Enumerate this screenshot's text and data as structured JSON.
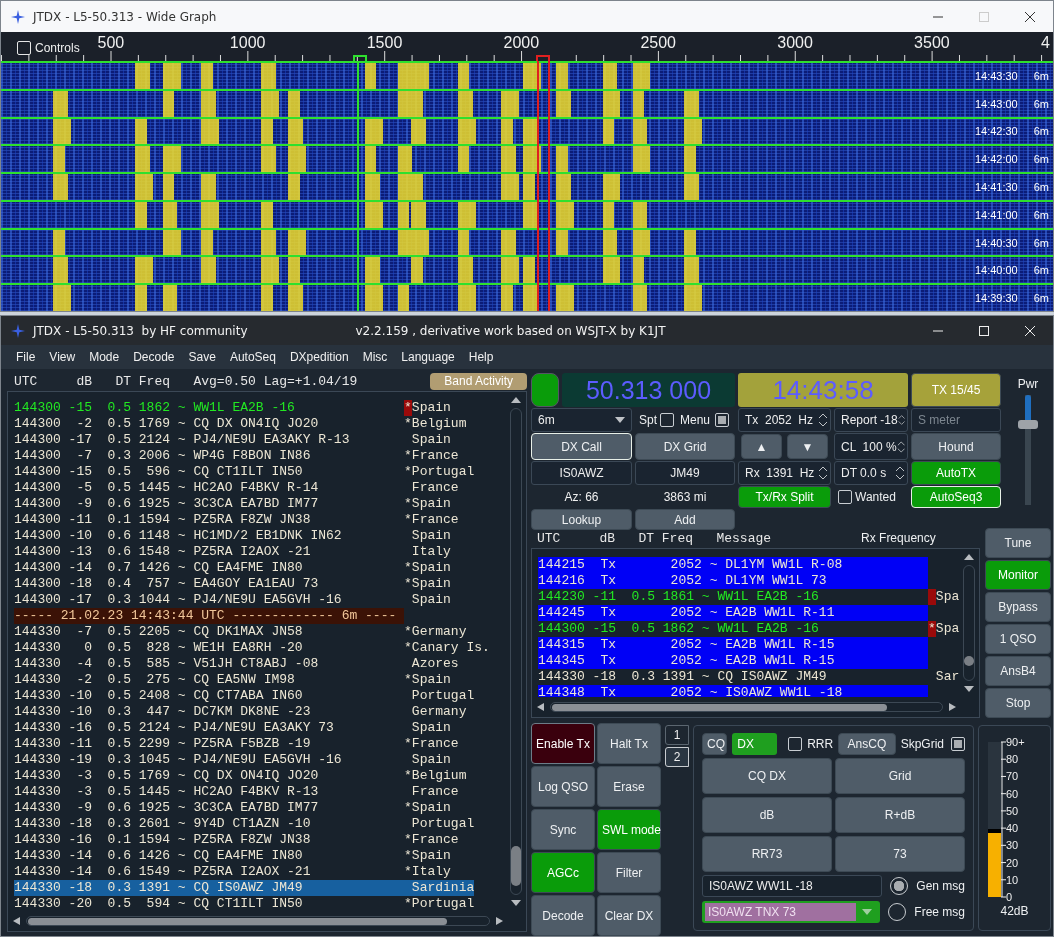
{
  "wide_graph": {
    "title": "JTDX - L5-50.313 - Wide Graph",
    "controls": {
      "label": "Controls",
      "checked": false
    },
    "scale_labels": [
      "500",
      "1000",
      "1500",
      "2000",
      "2500",
      "3000",
      "3500",
      "4"
    ],
    "rows": [
      {
        "time": "14:43:30",
        "band": "6m"
      },
      {
        "time": "14:43:00",
        "band": "6m"
      },
      {
        "time": "14:42:30",
        "band": "6m"
      },
      {
        "time": "14:42:00",
        "band": "6m"
      },
      {
        "time": "14:41:30",
        "band": "6m"
      },
      {
        "time": "14:41:00",
        "band": "6m"
      },
      {
        "time": "14:40:30",
        "band": "6m"
      },
      {
        "time": "14:40:00",
        "band": "6m"
      },
      {
        "time": "14:39:30",
        "band": "6m"
      }
    ]
  },
  "main_window": {
    "title": "JTDX - L5-50.313  by HF community",
    "subtitle": "v2.2.159 , derivative work based on WSJT-X by K1JT"
  },
  "menu": [
    "File",
    "View",
    "Mode",
    "Decode",
    "Save",
    "AutoSeq",
    "DXpedition",
    "Misc",
    "Language",
    "Help"
  ],
  "band_activity": {
    "header": "UTC     dB   DT Freq   Avg=0.50 Lag=+1.04/19",
    "button": "Band Activity",
    "rows": [
      {
        "kind": "mine",
        "text": "144300 -15  0.5 1862 ~ WW1L EA2B -16",
        "marker": "*",
        "flagged": true,
        "country": "Spain",
        "selected": false
      },
      {
        "kind": "decode",
        "text": "144300  -2  0.5 1769 ~ CQ DX ON4IQ JO20",
        "marker": "*",
        "flagged": false,
        "country": "Belgium",
        "selected": false
      },
      {
        "kind": "decode",
        "text": "144300 -17  0.5 2124 ~ PJ4/NE9U EA3AKY R-13",
        "flagged": false,
        "country": "Spain",
        "selected": false
      },
      {
        "kind": "decode",
        "text": "144300  -7  0.3 2006 ~ WP4G F8BON IN86",
        "marker": "*",
        "flagged": false,
        "country": "France",
        "selected": false
      },
      {
        "kind": "decode",
        "text": "144300 -15  0.5  596 ~ CQ CT1ILT IN50",
        "marker": "*",
        "flagged": false,
        "country": "Portugal",
        "selected": false
      },
      {
        "kind": "decode",
        "text": "144300  -5  0.5 1445 ~ HC2AO F4BKV R-14",
        "flagged": false,
        "country": "France",
        "selected": false
      },
      {
        "kind": "decode",
        "text": "144300  -9  0.6 1925 ~ 3C3CA EA7BD IM77",
        "marker": "*",
        "flagged": false,
        "country": "Spain",
        "selected": false
      },
      {
        "kind": "decode",
        "text": "144300 -11  0.1 1594 ~ PZ5RA F8ZW JN38",
        "marker": "*",
        "flagged": false,
        "country": "France",
        "selected": false
      },
      {
        "kind": "decode",
        "text": "144300 -10  0.6 1148 ~ HC1MD/2 EB1DNK IN62",
        "flagged": false,
        "country": "Spain",
        "selected": false
      },
      {
        "kind": "decode",
        "text": "144300 -13  0.6 1548 ~ PZ5RA I2AOX -21",
        "flagged": false,
        "country": "Italy",
        "selected": false
      },
      {
        "kind": "decode",
        "text": "144300 -14  0.7 1426 ~ CQ EA4FME IN80",
        "marker": "*",
        "flagged": false,
        "country": "Spain",
        "selected": false
      },
      {
        "kind": "decode",
        "text": "144300 -18  0.4  757 ~ EA4GOY EA1EAU 73",
        "marker": "*",
        "flagged": false,
        "country": "Spain",
        "selected": false
      },
      {
        "kind": "decode",
        "text": "144300 -17  0.3 1044 ~ PJ4/NE9U EA5GVH -16",
        "flagged": false,
        "country": "Spain",
        "selected": false
      },
      {
        "kind": "separator",
        "text": "----- 21.02.23 14:43:44 UTC ------------- 6m ----"
      },
      {
        "kind": "decode",
        "text": "144330  -7  0.5 2205 ~ CQ DK1MAX JN58",
        "marker": "*",
        "flagged": false,
        "country": "Germany",
        "selected": false
      },
      {
        "kind": "decode",
        "text": "144330   0  0.5  828 ~ WE1H EA8RH -20",
        "marker": "*",
        "flagged": false,
        "country": "Canary Is.",
        "selected": false
      },
      {
        "kind": "decode",
        "text": "144330  -4  0.5  585 ~ V51JH CT8ABJ -08",
        "flagged": false,
        "country": "Azores",
        "selected": false
      },
      {
        "kind": "decode",
        "text": "144330  -2  0.5  275 ~ CQ EA5NW IM98",
        "marker": "*",
        "flagged": false,
        "country": "Spain",
        "selected": false
      },
      {
        "kind": "decode",
        "text": "144330 -10  0.5 2408 ~ CQ CT7ABA IN60",
        "flagged": false,
        "country": "Portugal",
        "selected": false
      },
      {
        "kind": "decode",
        "text": "144330 -10  0.3  447 ~ DC7KM DK8NE -23",
        "flagged": false,
        "country": "Germany",
        "selected": false
      },
      {
        "kind": "decode",
        "text": "144330 -16  0.5 2124 ~ PJ4/NE9U EA3AKY 73",
        "flagged": false,
        "country": "Spain",
        "selected": false
      },
      {
        "kind": "decode",
        "text": "144330 -11  0.5 2299 ~ PZ5RA F5BZB -19",
        "marker": "*",
        "flagged": false,
        "country": "France",
        "selected": false
      },
      {
        "kind": "decode",
        "text": "144330 -19  0.3 1045 ~ PJ4/NE9U EA5GVH -16",
        "flagged": false,
        "country": "Spain",
        "selected": false
      },
      {
        "kind": "decode",
        "text": "144330  -3  0.5 1769 ~ CQ DX ON4IQ JO20",
        "marker": "*",
        "flagged": false,
        "country": "Belgium",
        "selected": false
      },
      {
        "kind": "decode",
        "text": "144330  -3  0.5 1445 ~ HC2AO F4BKV R-13",
        "flagged": false,
        "country": "France",
        "selected": false
      },
      {
        "kind": "decode",
        "text": "144330  -9  0.6 1925 ~ 3C3CA EA7BD IM77",
        "marker": "*",
        "flagged": false,
        "country": "Spain",
        "selected": false
      },
      {
        "kind": "decode",
        "text": "144330 -18  0.3 2601 ~ 9Y4D CT1AZN -10",
        "flagged": false,
        "country": "Portugal",
        "selected": false
      },
      {
        "kind": "decode",
        "text": "144330 -16  0.1 1594 ~ PZ5RA F8ZW JN38",
        "marker": "*",
        "flagged": false,
        "country": "France",
        "selected": false
      },
      {
        "kind": "decode",
        "text": "144330 -14  0.6 1426 ~ CQ EA4FME IN80",
        "marker": "*",
        "flagged": false,
        "country": "Spain",
        "selected": false
      },
      {
        "kind": "decode",
        "text": "144330 -14  0.6 1549 ~ PZ5RA I2AOX -21",
        "marker": "*",
        "flagged": false,
        "country": "Italy",
        "selected": false
      },
      {
        "kind": "decode",
        "text": "144330 -18  0.3 1391 ~ CQ IS0AWZ JM49",
        "flagged": false,
        "country": "Sardinia",
        "selected": true
      },
      {
        "kind": "decode",
        "text": "144330 -20  0.5  594 ~ CQ CT1ILT IN50",
        "marker": "*",
        "flagged": false,
        "country": "Portugal",
        "selected": false
      }
    ]
  },
  "controls": {
    "status_led": {
      "on": true
    },
    "frequency": "50.313 000",
    "clock": "14:43:58",
    "tx_period": "TX 15/45",
    "band": "6m",
    "spt": {
      "label": "Spt",
      "checked": false
    },
    "menu_toggle": {
      "label": "Menu",
      "checked": true
    },
    "tx_freq": "Tx  2052  Hz",
    "report": "Report -18",
    "s_meter": {
      "placeholder": "S meter"
    },
    "dx_call_button": "DX Call",
    "dx_grid_button": "DX Grid",
    "up": "▲",
    "down": "▼",
    "cl": "CL  100 %",
    "hound": {
      "label": "Hound",
      "on": false
    },
    "dx_call": "IS0AWZ",
    "dx_grid": "JM49",
    "rx_freq": "Rx  1391  Hz",
    "dt": "DT 0.0 s",
    "autotx": {
      "label": "AutoTX",
      "on": true
    },
    "azimuth": "Az: 66",
    "distance": "3863 mi",
    "split": {
      "label": "Tx/Rx Split",
      "on": true
    },
    "wanted": {
      "label": "Wanted",
      "checked": false
    },
    "autoseq": {
      "label": "AutoSeq3",
      "on": true
    },
    "lookup": "Lookup",
    "add": "Add",
    "pwr": {
      "label": "Pwr",
      "level": 0.75
    }
  },
  "rx_frequency": {
    "header": "UTC     dB   DT Freq   Message",
    "title": "Rx Frequency",
    "rows": [
      {
        "kind": "tx",
        "text": "144215  Tx       2052 ~ DL1YM WW1L R-08",
        "flagged": false
      },
      {
        "kind": "tx",
        "text": "144216  Tx       2052 ~ DL1YM WW1L 73",
        "flagged": false
      },
      {
        "kind": "mine",
        "text": "144230 -11  0.5 1861 ~ WW1L EA2B -16",
        "flagged": true,
        "country": "Spa"
      },
      {
        "kind": "tx",
        "text": "144245  Tx       2052 ~ EA2B WW1L R-11",
        "flagged": false
      },
      {
        "kind": "mine",
        "text": "144300 -15  0.5 1862 ~ WW1L EA2B -16",
        "marker": "*",
        "flagged": true,
        "country": "Spa"
      },
      {
        "kind": "tx",
        "text": "144315  Tx       2052 ~ EA2B WW1L R-15",
        "flagged": false
      },
      {
        "kind": "tx",
        "text": "144345  Tx       2052 ~ EA2B WW1L R-15",
        "flagged": false
      },
      {
        "kind": "decode",
        "text": "144330 -18  0.3 1391 ~ CQ IS0AWZ JM49",
        "flagged": false,
        "country": "Sar"
      },
      {
        "kind": "tx",
        "text": "144348  Tx       2052 ~ IS0AWZ WW1L -18",
        "flagged": false
      }
    ]
  },
  "side_buttons": [
    {
      "label": "Tune",
      "kind": "normal"
    },
    {
      "label": "Monitor",
      "kind": "active"
    },
    {
      "label": "Bypass",
      "kind": "normal"
    },
    {
      "label": "1 QSO",
      "kind": "normal"
    },
    {
      "label": "AnsB4",
      "kind": "normal"
    },
    {
      "label": "Stop",
      "kind": "normal"
    }
  ],
  "action_buttons": [
    {
      "label": "Enable Tx",
      "kind": "alert"
    },
    {
      "label": "Halt Tx",
      "kind": "normal"
    },
    {
      "label": "Log QSO",
      "kind": "normal"
    },
    {
      "label": "Erase",
      "kind": "normal"
    },
    {
      "label": "Sync",
      "kind": "normal"
    },
    {
      "label": "SWL mode",
      "kind": "active"
    },
    {
      "label": "AGCc",
      "kind": "active"
    },
    {
      "label": "Filter",
      "kind": "normal"
    },
    {
      "label": "Decode",
      "kind": "normal"
    },
    {
      "label": "Clear DX",
      "kind": "normal"
    }
  ],
  "tab_panel": {
    "tabs": [
      {
        "label": "1",
        "selected": false
      },
      {
        "label": "2",
        "selected": true
      }
    ],
    "cq_button": "CQ",
    "dx_field": "DX",
    "rrr": {
      "label": "RRR",
      "checked": false
    },
    "anscq": "AnsCQ",
    "skpgrid": {
      "label": "SkpGrid",
      "checked": true
    },
    "buttons": [
      "CQ DX",
      "Grid",
      "dB",
      "R+dB",
      "RR73",
      "73"
    ],
    "message_field": "IS0AWZ WW1L -18",
    "free_message": "IS0AWZ TNX 73",
    "radios": [
      {
        "label": "Gen msg",
        "selected": true
      },
      {
        "label": "Free msg",
        "selected": false
      }
    ]
  },
  "meter": {
    "scale": [
      "90+",
      "80",
      "70",
      "60",
      "50",
      "40",
      "30",
      "20",
      "10",
      "0"
    ],
    "level": 0.44,
    "reading": "42dB"
  }
}
